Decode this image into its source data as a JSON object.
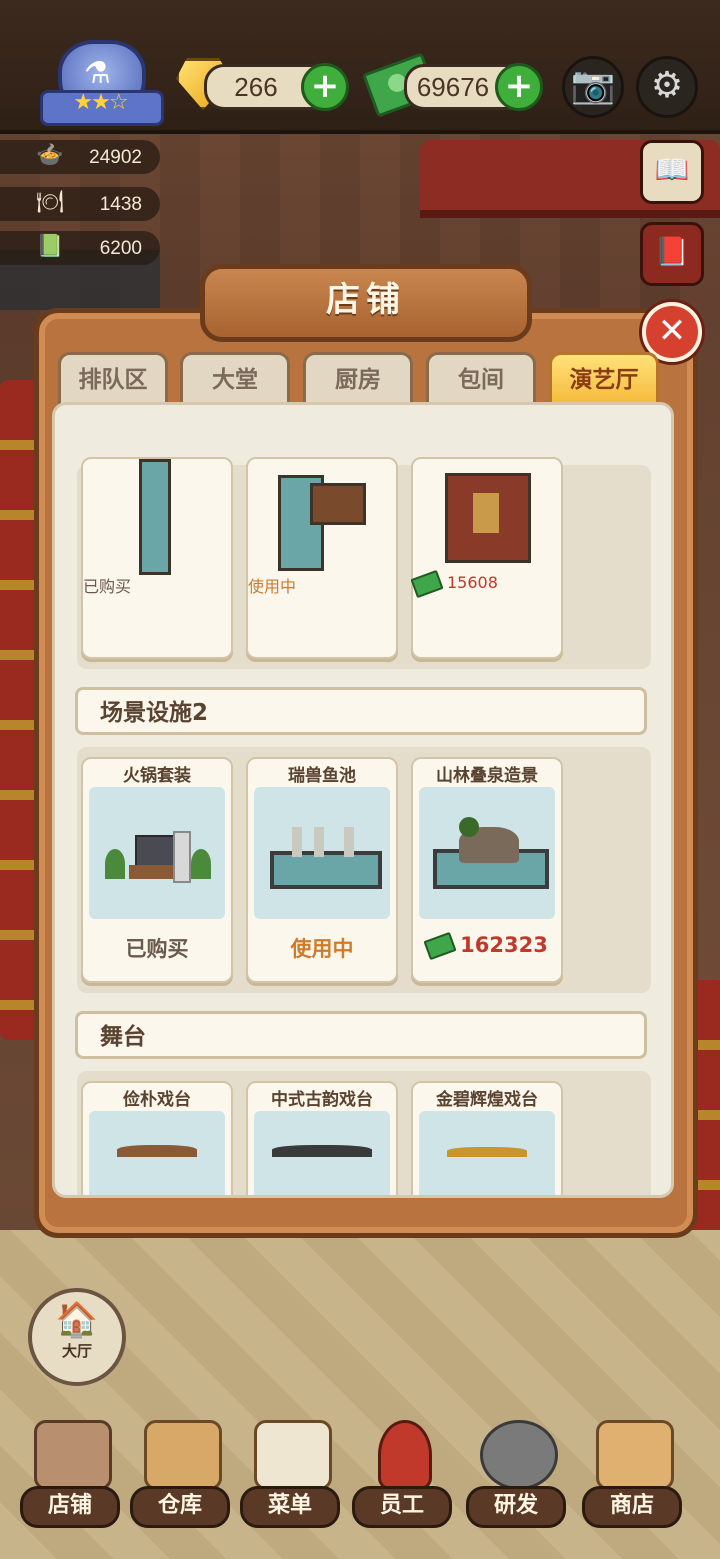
{
  "hud": {
    "gems": "266",
    "cash": "69676",
    "stats": [
      {
        "icon": "food-bowl-icon",
        "value": "24902"
      },
      {
        "icon": "dish-cover-icon",
        "value": "1438"
      },
      {
        "icon": "menu-book-icon",
        "value": "6200"
      }
    ]
  },
  "panel": {
    "title": "店铺",
    "tabs": [
      {
        "label": "排队区",
        "active": false
      },
      {
        "label": "大堂",
        "active": false
      },
      {
        "label": "厨房",
        "active": false
      },
      {
        "label": "包间",
        "active": false
      },
      {
        "label": "演艺厅",
        "active": true
      }
    ],
    "section1_items": [
      {
        "status": "已购买",
        "kind": "bought"
      },
      {
        "status": "使用中",
        "kind": "inuse"
      },
      {
        "status": "15608",
        "kind": "price"
      }
    ],
    "section2": {
      "header": "场景设施2",
      "items": [
        {
          "name": "火锅套装",
          "status": "已购买",
          "kind": "bought"
        },
        {
          "name": "瑞兽鱼池",
          "status": "使用中",
          "kind": "inuse"
        },
        {
          "name": "山林叠泉造景",
          "status": "162323",
          "kind": "price"
        }
      ]
    },
    "section3": {
      "header": "舞台",
      "items": [
        {
          "name": "俭朴戏台"
        },
        {
          "name": "中式古韵戏台"
        },
        {
          "name": "金碧辉煌戏台"
        }
      ]
    }
  },
  "hall_button": {
    "label": "大厅"
  },
  "bottom_nav": [
    {
      "label": "店铺",
      "icon": "shop-building-icon"
    },
    {
      "label": "仓库",
      "icon": "boxes-icon"
    },
    {
      "label": "菜单",
      "icon": "checklist-icon"
    },
    {
      "label": "员工",
      "icon": "chef-girl-icon"
    },
    {
      "label": "研发",
      "icon": "wok-icon"
    },
    {
      "label": "商店",
      "icon": "store-icon"
    }
  ],
  "colors": {
    "accent": "#f6b93a",
    "price": "#c0392b",
    "in_use": "#d07a2c",
    "frame": "#b8733e"
  }
}
